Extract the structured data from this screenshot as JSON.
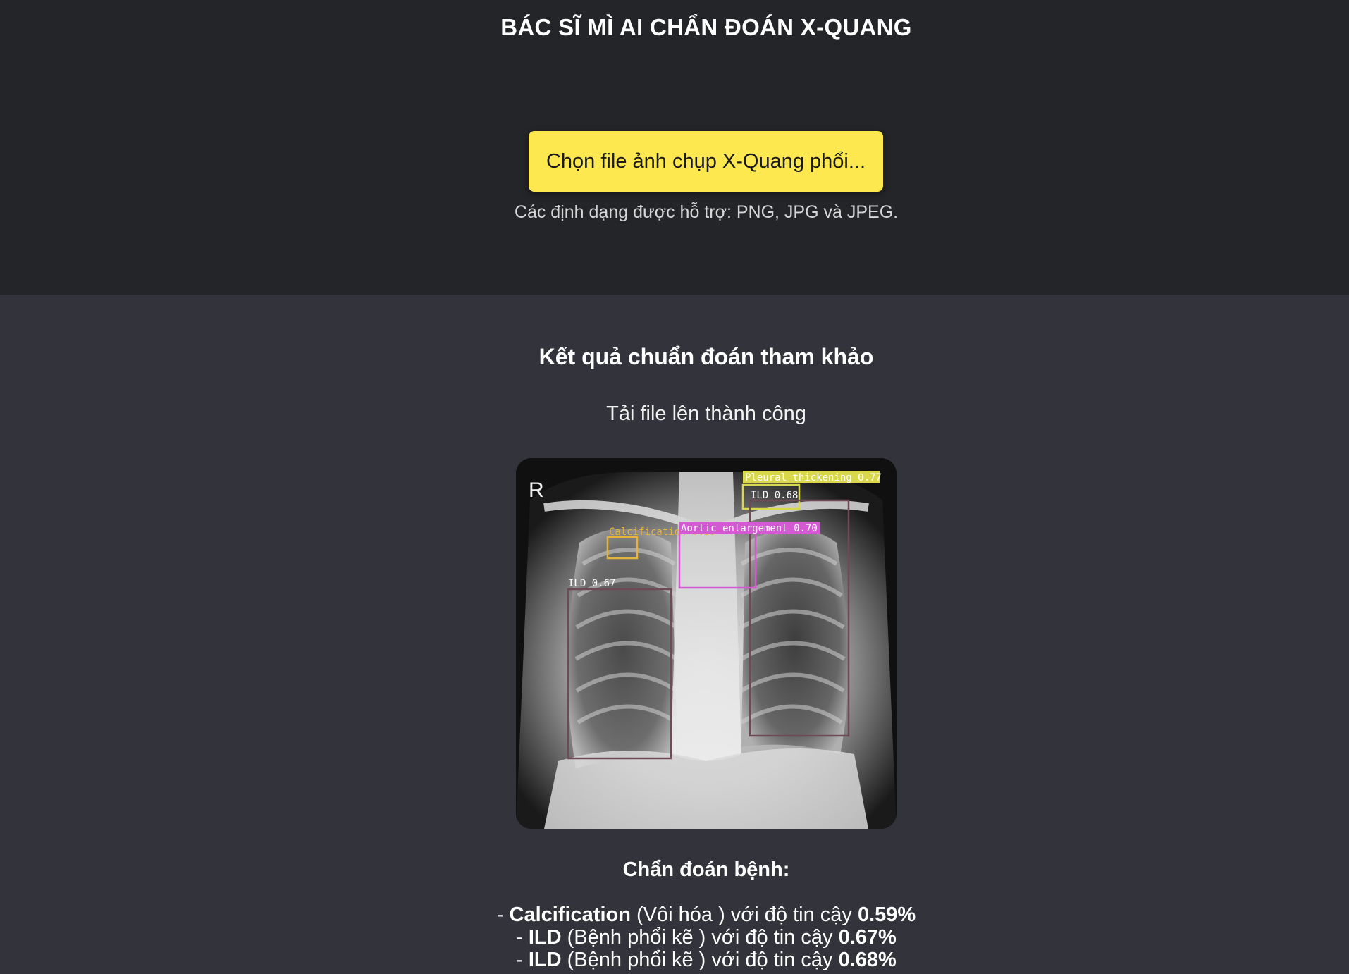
{
  "header": {
    "title": "BÁC SĨ MÌ AI CHẨN ĐOÁN X-QUANG"
  },
  "upload": {
    "button_label": "Chọn file ảnh chụp X-Quang phổi...",
    "formats_note": "Các định dạng được hỗ trợ: PNG, JPG và JPEG."
  },
  "results": {
    "title": "Kết quả chuẩn đoán tham khảo",
    "status": "Tải file lên thành công",
    "image": {
      "marker": "R",
      "detections": [
        {
          "label": "Pleural  thickening  0.77",
          "color": "#d8d84a"
        },
        {
          "label": "ILD  0.68",
          "color": "#6e4a55"
        },
        {
          "label": "Calcification  0.59",
          "color": "#e6b43a"
        },
        {
          "label": "Aortic  enlargement  0.70",
          "color": "#d35ad3"
        },
        {
          "label": "ILD  0.67",
          "color": "#6e4a55"
        }
      ]
    },
    "diagnosis": {
      "title": "Chẩn đoán bệnh:",
      "items": [
        {
          "prefix": "- ",
          "name": "Calcification",
          "desc": " (Vôi hóa ) với độ tin cậy ",
          "confidence": "0.59%"
        },
        {
          "prefix": "- ",
          "name": "ILD",
          "desc": " (Bệnh phổi kẽ ) với độ tin cậy ",
          "confidence": "0.67%"
        },
        {
          "prefix": "- ",
          "name": "ILD",
          "desc": " (Bệnh phổi kẽ ) với độ tin cậy ",
          "confidence": "0.68%"
        }
      ]
    }
  }
}
